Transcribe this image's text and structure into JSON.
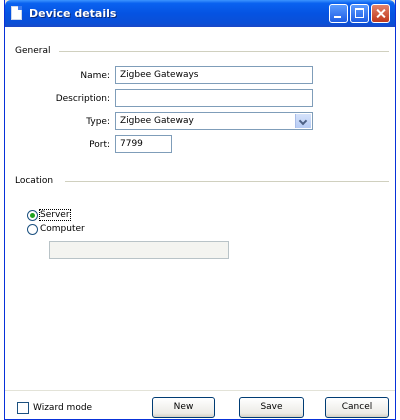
{
  "window": {
    "title": "Device details"
  },
  "general": {
    "section_label": "General",
    "name_label": "Name:",
    "name_value": "Zigbee Gateways",
    "description_label": "Description:",
    "description_value": "",
    "type_label": "Type:",
    "type_value": "Zigbee Gateway",
    "port_label": "Port:",
    "port_value": "7799"
  },
  "location": {
    "section_label": "Location",
    "options": [
      {
        "label": "Server",
        "selected": true
      },
      {
        "label": "Computer",
        "selected": false
      }
    ],
    "computer_value": ""
  },
  "footer": {
    "wizard_mode_label": "Wizard mode",
    "wizard_mode_checked": false,
    "new_label": "New",
    "save_label": "Save",
    "cancel_label": "Cancel"
  },
  "icons": [
    "document-icon",
    "minimize-icon",
    "maximize-icon",
    "close-icon",
    "chevron-down-icon"
  ]
}
